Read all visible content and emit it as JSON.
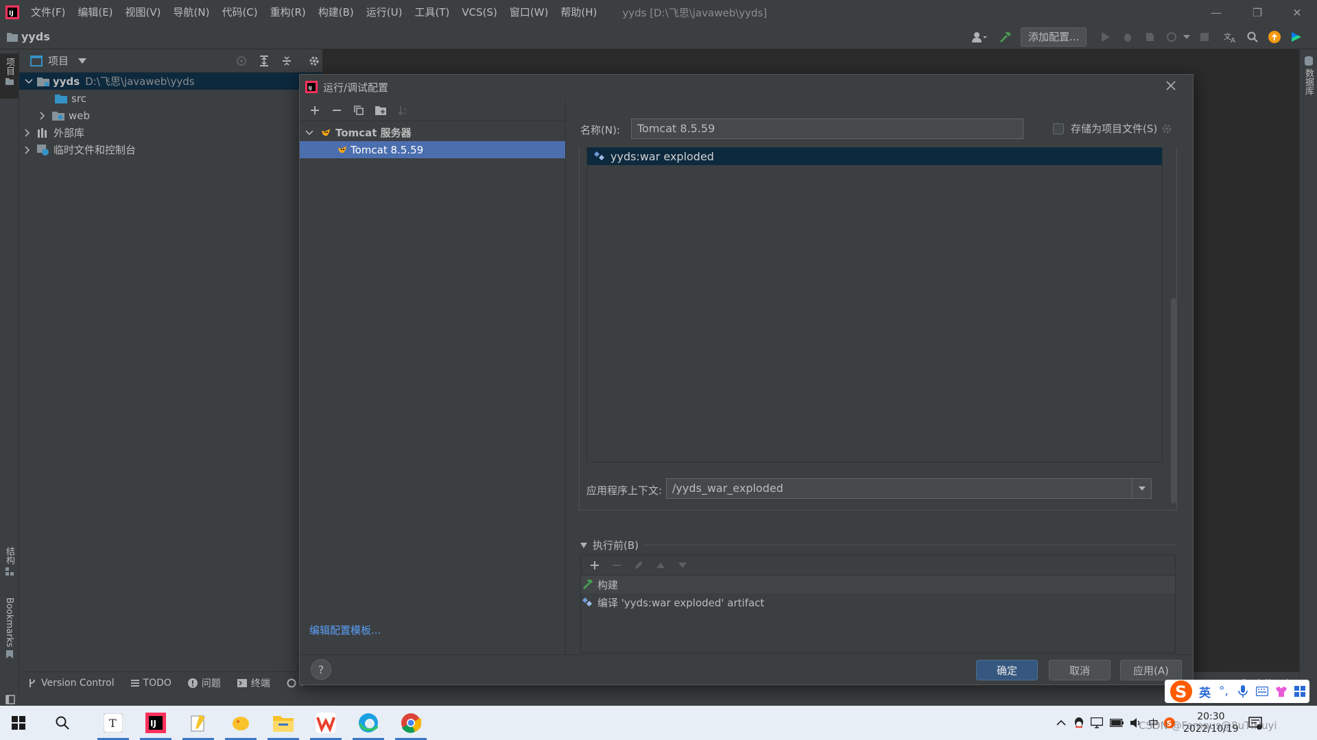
{
  "menubar": {
    "items": [
      "文件(F)",
      "编辑(E)",
      "视图(V)",
      "导航(N)",
      "代码(C)",
      "重构(R)",
      "构建(B)",
      "运行(U)",
      "工具(T)",
      "VCS(S)",
      "窗口(W)",
      "帮助(H)"
    ],
    "window_title": "yyds [D:\\飞思\\javaweb\\yyds]"
  },
  "navbar": {
    "project": "yyds",
    "add_config": "添加配置..."
  },
  "left_stripe": {
    "project": "项目",
    "structure": "结构",
    "bookmarks": "Bookmarks"
  },
  "right_stripe": {
    "database": "数据库"
  },
  "project_panel": {
    "title": "项目",
    "tree": {
      "root_name": "yyds",
      "root_path": "D:\\飞思\\javaweb\\yyds",
      "src": "src",
      "web": "web",
      "external": "外部库",
      "scratch": "临时文件和控制台"
    }
  },
  "bottom_bar": {
    "version_control": "Version Control",
    "todo": "TODO",
    "problems": "问题",
    "terminal": "终端",
    "profiler": "P",
    "event_log": "事件日志"
  },
  "dialog": {
    "title": "运行/调试配置",
    "tree": {
      "group": "Tomcat 服务器",
      "item": "Tomcat 8.5.59"
    },
    "edit_templates": "编辑配置模板...",
    "name_label": "名称(N):",
    "name_value": "Tomcat 8.5.59",
    "store_as_file": "存储为项目文件(S)",
    "deploy_item": "yyds:war exploded",
    "context_label": "应用程序上下文:",
    "context_value": "/yyds_war_exploded",
    "before_launch": "执行前(B)",
    "tasks": [
      "构建",
      "编译 'yyds:war exploded' artifact"
    ],
    "buttons": {
      "ok": "确定",
      "cancel": "取消",
      "apply": "应用(A)"
    },
    "help": "?"
  },
  "taskbar": {
    "ime_lang": "英",
    "time": "20:30",
    "date": "2022/10/19",
    "watermark": "CSDN @Famous@8uTIHuyi"
  }
}
